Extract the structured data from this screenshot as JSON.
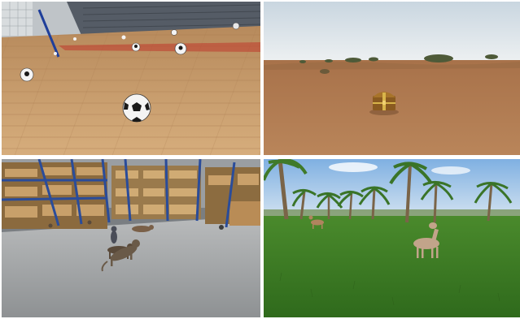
{
  "grid": {
    "panels": [
      {
        "id": "soccer-court",
        "icon": "soccer-ball-icon"
      },
      {
        "id": "desert",
        "icon": "treasure-chest-icon"
      },
      {
        "id": "warehouse",
        "icon": "cat-icon"
      },
      {
        "id": "palm-meadow",
        "icon": "deer-icon"
      }
    ]
  },
  "colors": {
    "floor_wood": "#c9a070",
    "desert_sand": "#b07a4e",
    "desert_sky": "#dde6ec",
    "warehouse_floor": "#9fa2a4",
    "rack_blue": "#2a4c9a",
    "grass": "#3f7a26",
    "meadow_sky": "#9cc3ea"
  }
}
